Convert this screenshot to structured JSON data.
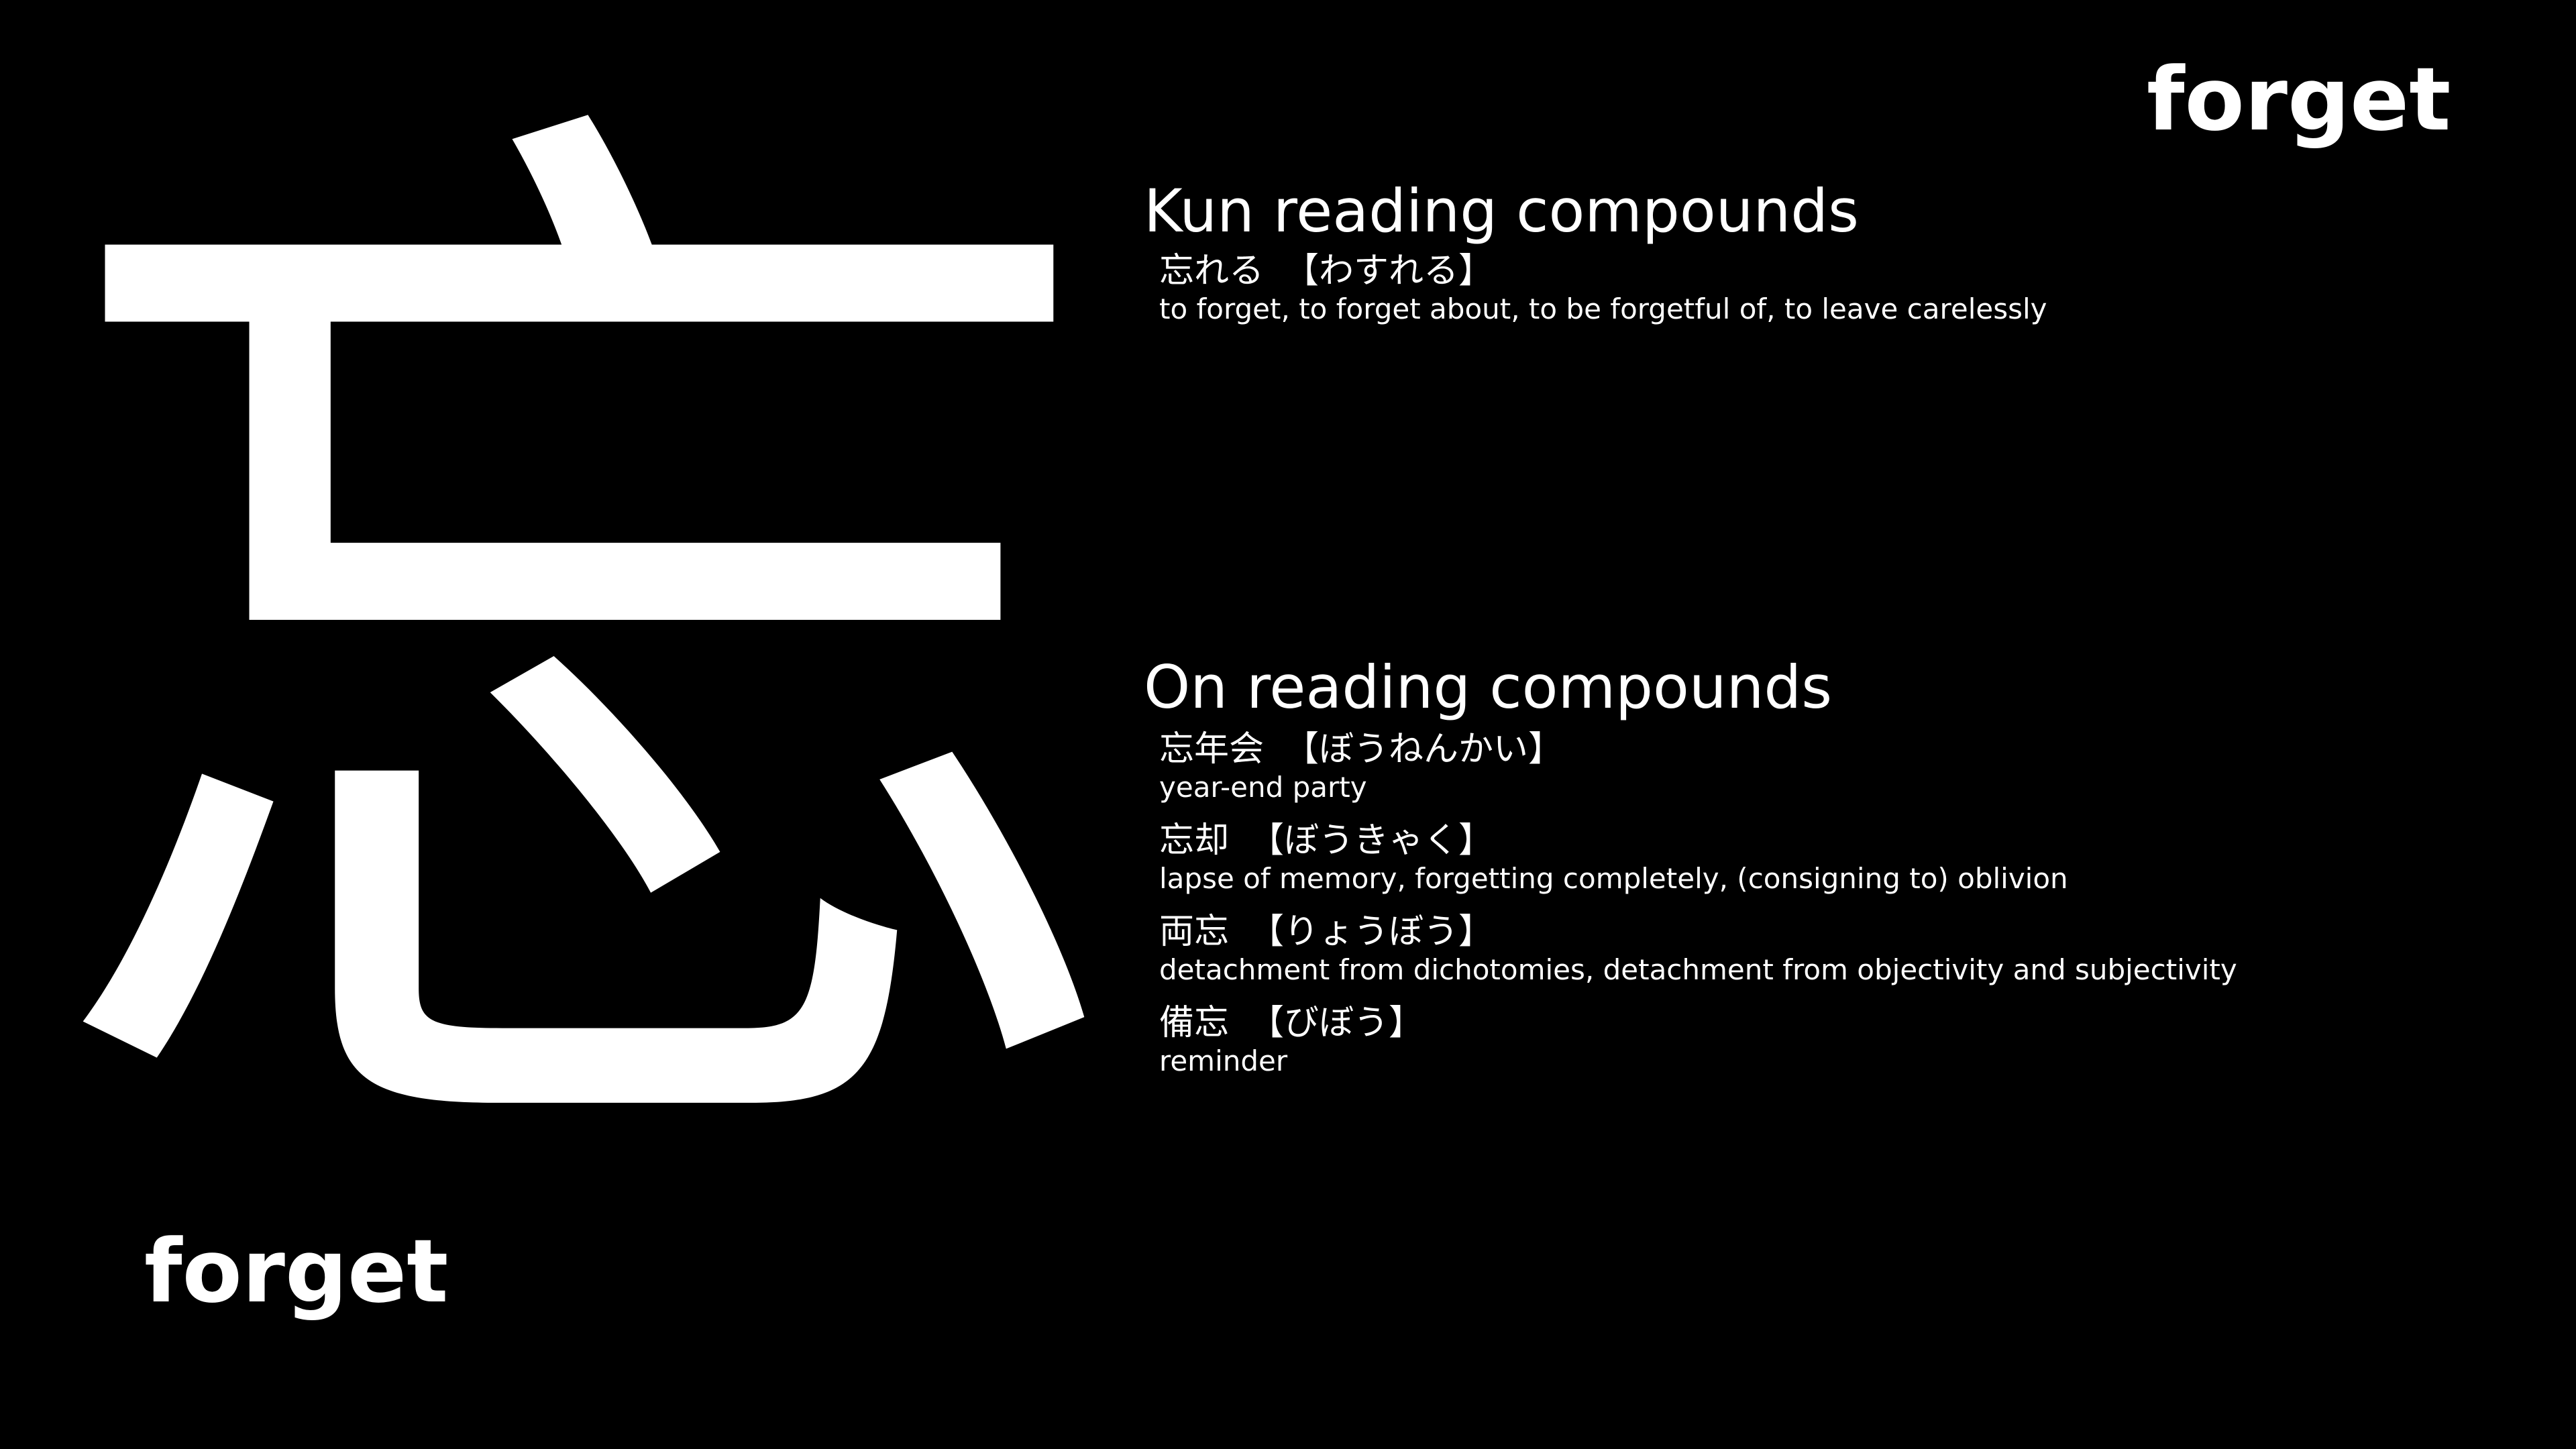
{
  "kanji": {
    "character": "忘",
    "meaning": "forget"
  },
  "header": {
    "meaning": "forget"
  },
  "kun": {
    "heading": "Kun reading compounds",
    "entries": [
      {
        "word": "忘れる",
        "reading": "【わすれる】",
        "meaning": "to forget, to forget about, to be forgetful of, to leave carelessly"
      }
    ]
  },
  "on": {
    "heading": "On reading compounds",
    "entries": [
      {
        "word": "忘年会",
        "reading": "【ぼうねんかい】",
        "meaning": "year-end party"
      },
      {
        "word": "忘却",
        "reading": "【ぼうきゃく】",
        "meaning": "lapse of memory, forgetting completely, (consigning to) oblivion"
      },
      {
        "word": "両忘",
        "reading": "【りょうぼう】",
        "meaning": "detachment from dichotomies, detachment from objectivity and subjectivity"
      },
      {
        "word": "備忘",
        "reading": "【びぼう】",
        "meaning": "reminder"
      }
    ]
  }
}
